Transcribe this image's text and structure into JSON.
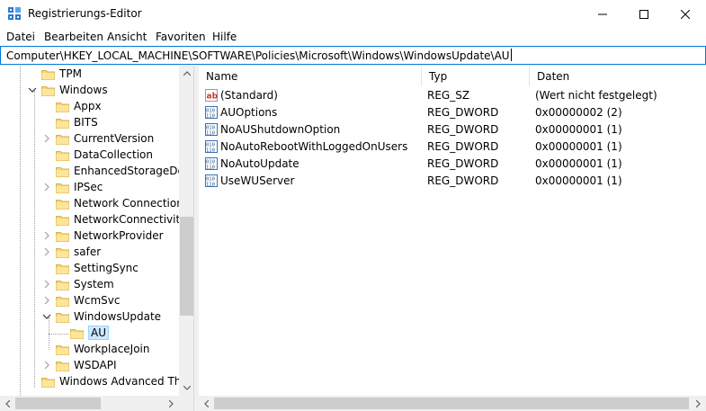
{
  "window": {
    "title": "Registrierungs-Editor",
    "icon": "regedit-icon"
  },
  "menu": {
    "items": [
      "Datei",
      "Bearbeiten",
      "Ansicht",
      "Favoriten",
      "Hilfe"
    ]
  },
  "address": {
    "path": "Computer\\HKEY_LOCAL_MACHINE\\SOFTWARE\\Policies\\Microsoft\\Windows\\WindowsUpdate\\AU"
  },
  "tree": {
    "items": [
      {
        "label": "TPM",
        "state": "collapsed-leaf",
        "selected": false
      },
      {
        "label": "Windows",
        "state": "expanded",
        "selected": false
      },
      {
        "label": "Appx",
        "state": "leaf",
        "selected": false
      },
      {
        "label": "BITS",
        "state": "leaf",
        "selected": false
      },
      {
        "label": "CurrentVersion",
        "state": "collapsed",
        "selected": false
      },
      {
        "label": "DataCollection",
        "state": "leaf",
        "selected": false
      },
      {
        "label": "EnhancedStorageDevi",
        "state": "leaf",
        "selected": false
      },
      {
        "label": "IPSec",
        "state": "collapsed",
        "selected": false
      },
      {
        "label": "Network Connections",
        "state": "leaf",
        "selected": false
      },
      {
        "label": "NetworkConnectivityS",
        "state": "leaf",
        "selected": false
      },
      {
        "label": "NetworkProvider",
        "state": "collapsed",
        "selected": false
      },
      {
        "label": "safer",
        "state": "collapsed",
        "selected": false
      },
      {
        "label": "SettingSync",
        "state": "leaf",
        "selected": false
      },
      {
        "label": "System",
        "state": "collapsed",
        "selected": false
      },
      {
        "label": "WcmSvc",
        "state": "collapsed",
        "selected": false
      },
      {
        "label": "WindowsUpdate",
        "state": "expanded",
        "selected": false
      },
      {
        "label": "AU",
        "state": "leaf",
        "selected": true
      },
      {
        "label": "WorkplaceJoin",
        "state": "leaf",
        "selected": false
      },
      {
        "label": "WSDAPI",
        "state": "collapsed",
        "selected": false
      },
      {
        "label": "Windows Advanced Thre",
        "state": "leaf",
        "selected": false
      }
    ]
  },
  "list": {
    "columns": [
      "Name",
      "Typ",
      "Daten"
    ],
    "rows": [
      {
        "name": "(Standard)",
        "type": "REG_SZ",
        "data": "(Wert nicht festgelegt)",
        "icon": "string-value-icon"
      },
      {
        "name": "AUOptions",
        "type": "REG_DWORD",
        "data": "0x00000002 (2)",
        "icon": "binary-value-icon"
      },
      {
        "name": "NoAUShutdownOption",
        "type": "REG_DWORD",
        "data": "0x00000001 (1)",
        "icon": "binary-value-icon"
      },
      {
        "name": "NoAutoRebootWithLoggedOnUsers",
        "type": "REG_DWORD",
        "data": "0x00000001 (1)",
        "icon": "binary-value-icon"
      },
      {
        "name": "NoAutoUpdate",
        "type": "REG_DWORD",
        "data": "0x00000001 (1)",
        "icon": "binary-value-icon"
      },
      {
        "name": "UseWUServer",
        "type": "REG_DWORD",
        "data": "0x00000001 (1)",
        "icon": "binary-value-icon"
      }
    ]
  },
  "colors": {
    "accent": "#0078d7",
    "selection": "#cce8ff",
    "folder": "#f8d775",
    "scrollbar": "#f0f0f0"
  }
}
